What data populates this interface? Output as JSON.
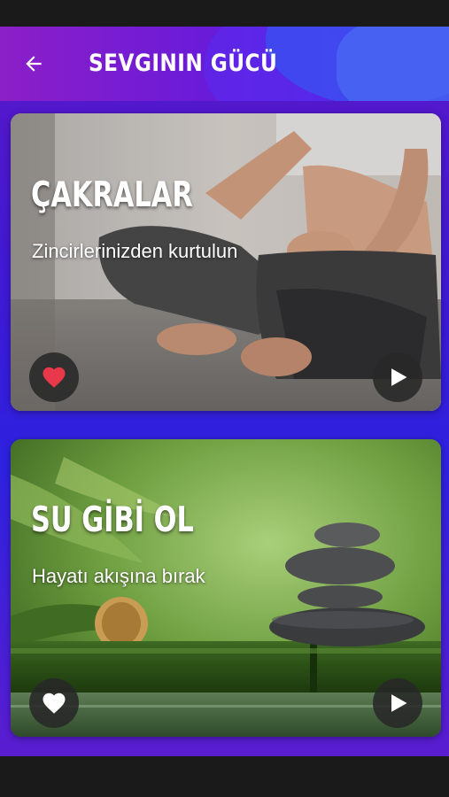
{
  "header": {
    "title": "SEVGININ GÜCÜ",
    "back_icon": "arrow-left-icon",
    "gradient": [
      "#8c1fc7",
      "#3a2ae6"
    ]
  },
  "cards": [
    {
      "title": "ÇAKRALAR",
      "subtitle": "Zincirlerinizden kurtulun",
      "favorite": true,
      "favorite_icon": "heart-filled-icon",
      "favorite_color": "#e8384a",
      "play_icon": "play-icon",
      "image_subject": "yoga-meditation-photo"
    },
    {
      "title": "SU GİBİ OL",
      "subtitle": "Hayatı akışına bırak",
      "favorite": false,
      "favorite_icon": "heart-filled-icon",
      "favorite_color": "#ffffff",
      "play_icon": "play-icon",
      "image_subject": "zen-stones-bamboo-photo"
    }
  ]
}
